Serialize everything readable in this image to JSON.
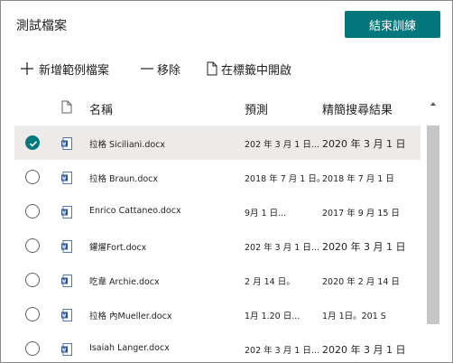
{
  "panel": {
    "title": "測試檔案",
    "end_training_label": "結束訓練"
  },
  "toolbar": {
    "add_label": "新增範例檔案",
    "remove_label": "移除",
    "open_tab_label": "在標籤中開啟"
  },
  "table": {
    "columns": {
      "name": "名稱",
      "prediction": "預測",
      "refined_result": "精簡搜尋結果"
    },
    "rows": [
      {
        "name": "拉格 Siciliani.docx",
        "prediction": "202 年 3 月 1 日...",
        "result": "2020 年 3 月 1 日",
        "selected": true
      },
      {
        "name": "拉格 Braun.docx",
        "prediction": "2018 年 7 月 1 日。",
        "result": "2018 年 7 月 1 日",
        "selected": false
      },
      {
        "name": "Enrico Cattaneo.docx",
        "prediction": "9月 1 日...",
        "result": "2017 年 9 月 15 日",
        "selected": false
      },
      {
        "name": "鑵燿Fort.docx",
        "prediction": "202 年 3 月 1 日...",
        "result": "2020 年 3 月 1 日",
        "selected": false
      },
      {
        "name": "吃韋 Archie.docx",
        "prediction": "2 月 14 日。",
        "result": "2020 年 2 月 14 日",
        "selected": false
      },
      {
        "name": "拉格 內Mueller.docx",
        "prediction": "1月 1.20 日...",
        "result": "1月 1日。201 S",
        "selected": false
      },
      {
        "name": "Isaiah Langer.docx",
        "prediction": "202 年 3 月 1 日...",
        "result": "2020 年 3 月 1 日",
        "selected": false
      }
    ]
  },
  "colors": {
    "accent": "#03787c",
    "selected_row": "#edebe9",
    "word_icon": "#2b579a"
  },
  "icons": {
    "add": "plus-icon",
    "remove": "minus-icon",
    "open_tab": "document-icon",
    "file": "word-document-icon",
    "check": "checkmark-icon"
  }
}
